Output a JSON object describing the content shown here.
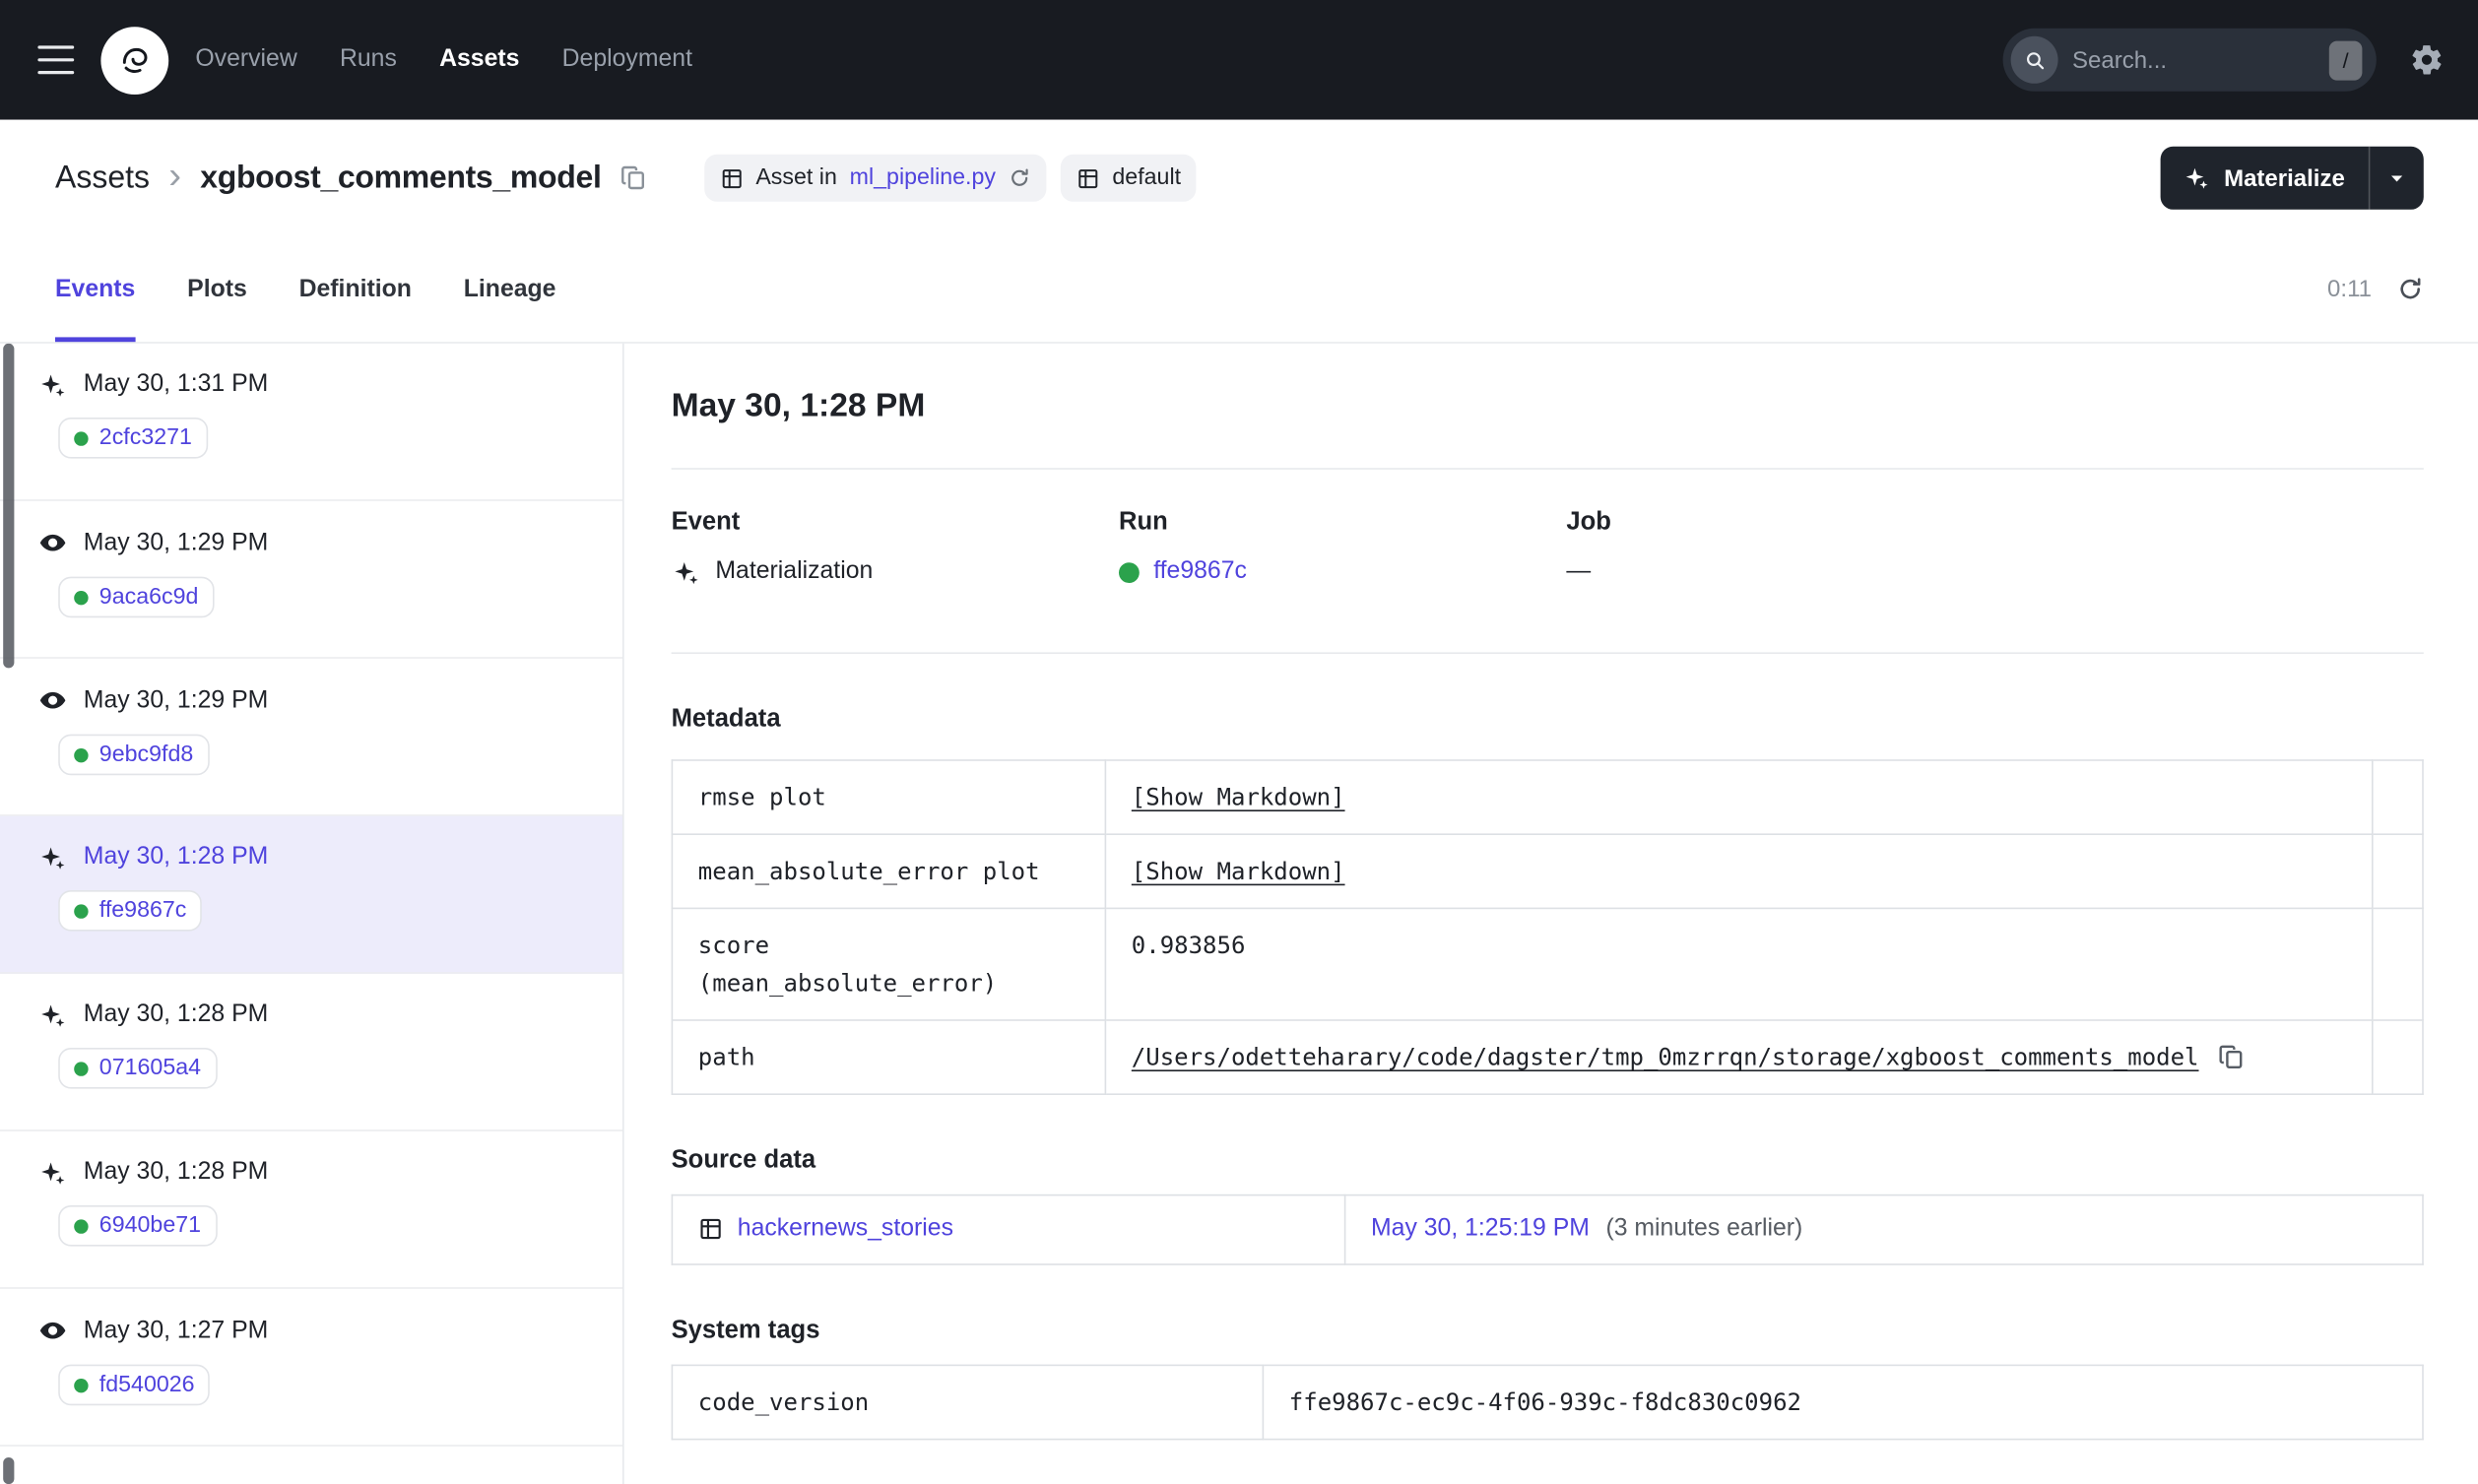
{
  "nav": {
    "items": [
      {
        "label": "Overview"
      },
      {
        "label": "Runs"
      },
      {
        "label": "Assets"
      },
      {
        "label": "Deployment"
      }
    ],
    "active": "Assets",
    "search": {
      "placeholder": "Search...",
      "shortcut": "/"
    }
  },
  "breadcrumb": {
    "root": "Assets",
    "separator": "›",
    "current": "xgboost_comments_model"
  },
  "asset_header": {
    "asset_tag": {
      "prefix": "Asset in",
      "file": "ml_pipeline.py"
    },
    "group_tag": "default",
    "materialize_label": "Materialize"
  },
  "tabs": {
    "items": [
      {
        "label": "Events"
      },
      {
        "label": "Plots"
      },
      {
        "label": "Definition"
      },
      {
        "label": "Lineage"
      }
    ],
    "active": "Events",
    "refresh_timer": "0:11"
  },
  "sidebar": {
    "events": [
      {
        "type": "materialization",
        "time": "May 30, 1:31 PM",
        "run_id": "2cfc3271",
        "selected": false
      },
      {
        "type": "observation",
        "time": "May 30, 1:29 PM",
        "run_id": "9aca6c9d",
        "selected": false
      },
      {
        "type": "observation",
        "time": "May 30, 1:29 PM",
        "run_id": "9ebc9fd8",
        "selected": false
      },
      {
        "type": "materialization",
        "time": "May 30, 1:28 PM",
        "run_id": "ffe9867c",
        "selected": true
      },
      {
        "type": "materialization",
        "time": "May 30, 1:28 PM",
        "run_id": "071605a4",
        "selected": false
      },
      {
        "type": "materialization",
        "time": "May 30, 1:28 PM",
        "run_id": "6940be71",
        "selected": false
      },
      {
        "type": "observation",
        "time": "May 30, 1:27 PM",
        "run_id": "fd540026",
        "selected": false
      }
    ]
  },
  "detail": {
    "title": "May 30, 1:28 PM",
    "summary": {
      "event_label": "Event",
      "event_value": "Materialization",
      "run_label": "Run",
      "run_value": "ffe9867c",
      "job_label": "Job",
      "job_value": "—"
    },
    "metadata": {
      "heading": "Metadata",
      "rows": [
        {
          "key": "rmse plot",
          "value": "[Show Markdown]"
        },
        {
          "key": "mean_absolute_error plot",
          "value": "[Show Markdown]"
        },
        {
          "key": "score\n(mean_absolute_error)",
          "value": "0.983856"
        },
        {
          "key": "path",
          "value": "/Users/odetteharary/code/dagster/tmp_0mzrrqn/storage/xgboost_comments_model"
        }
      ]
    },
    "source_data": {
      "heading": "Source data",
      "asset": "hackernews_stories",
      "timestamp": "May 30, 1:25:19 PM",
      "note": "(3 minutes earlier)"
    },
    "system_tags": {
      "heading": "System tags",
      "rows": [
        {
          "key": "code_version",
          "value": "ffe9867c-ec9c-4f06-939c-f8dc830c0962"
        }
      ]
    }
  },
  "colors": {
    "accent": "#4F43DD",
    "success_green": "#2BA24C",
    "nav_background": "#181B21",
    "selected_event_background": "#EDECFB"
  }
}
